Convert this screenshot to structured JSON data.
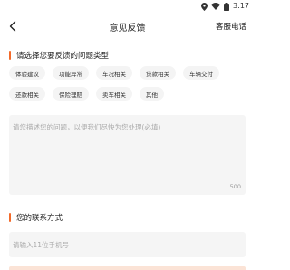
{
  "status_bar": {
    "time": "3:17",
    "icons": [
      "location-icon",
      "wifi-icon",
      "battery-icon"
    ]
  },
  "nav": {
    "title": "意见反馈",
    "action_label": "客服电话",
    "back_icon": "chevron-left-icon"
  },
  "issue_type": {
    "title": "请选择您要反馈的问题类型",
    "tags_row1": [
      "体验建议",
      "功能异常",
      "车况相关",
      "贷款相关",
      "车辆交付"
    ],
    "tags_row2": [
      "还款相关",
      "保险理赔",
      "卖车相关",
      "其他"
    ]
  },
  "description": {
    "placeholder": "请您描述您的问题，以便我们尽快为您处理(必填)",
    "counter": "500"
  },
  "contact": {
    "title": "您的联系方式",
    "placeholder": "请输入11位手机号"
  },
  "colors": {
    "accent": "#f36a2a",
    "field_bg": "#f5f5f5",
    "tag_bg": "#f4f4f4"
  }
}
